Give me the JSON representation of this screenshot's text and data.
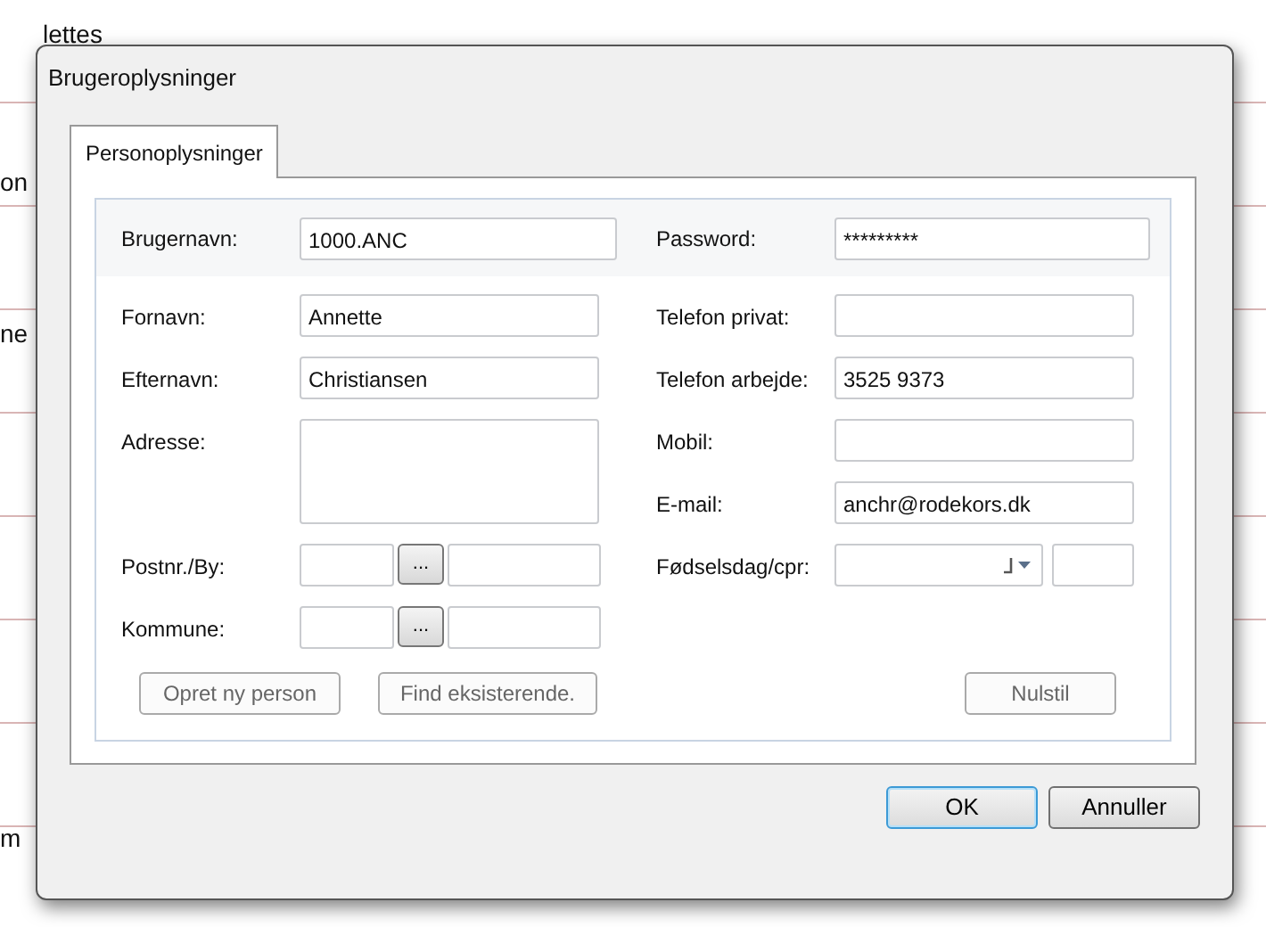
{
  "background": {
    "texts": [
      "lettes",
      "on",
      "ne",
      "m"
    ]
  },
  "dialog": {
    "title": "Brugeroplysninger",
    "tabs": [
      {
        "label": "Personoplysninger",
        "selected": true
      }
    ],
    "login": {
      "username_label": "Brugernavn:",
      "username": "1000.ANC",
      "password_label": "Password:",
      "password": "*********"
    },
    "left_fields": [
      {
        "kind": "text",
        "label": "Fornavn:",
        "value": "Annette"
      },
      {
        "kind": "text",
        "label": "Efternavn:",
        "value": "Christiansen"
      },
      {
        "kind": "multiline",
        "label": "Adresse:"
      },
      {
        "kind": "lookup",
        "label": "Postnr./By:",
        "button": "..."
      },
      {
        "kind": "lookup",
        "label": "Kommune:",
        "button": "..."
      }
    ],
    "right_fields": [
      {
        "kind": "text",
        "label": "Telefon privat:"
      },
      {
        "kind": "text",
        "label": "Telefon arbejde:",
        "value": "3525 9373"
      },
      {
        "kind": "text",
        "label": "Mobil:"
      },
      {
        "kind": "text",
        "label": "E-mail:",
        "value": "anchr@rodekors.dk"
      },
      {
        "kind": "date",
        "label": "Fødselsdag/cpr:"
      }
    ],
    "actions": [
      {
        "label": "Opret ny person",
        "disabled": true
      },
      {
        "label": "Find eksisterende.",
        "disabled": true
      },
      {
        "label": "Nulstil",
        "disabled": true
      }
    ],
    "buttons": [
      {
        "label": "OK",
        "default": true
      },
      {
        "label": "Annuller",
        "default": false
      }
    ]
  }
}
